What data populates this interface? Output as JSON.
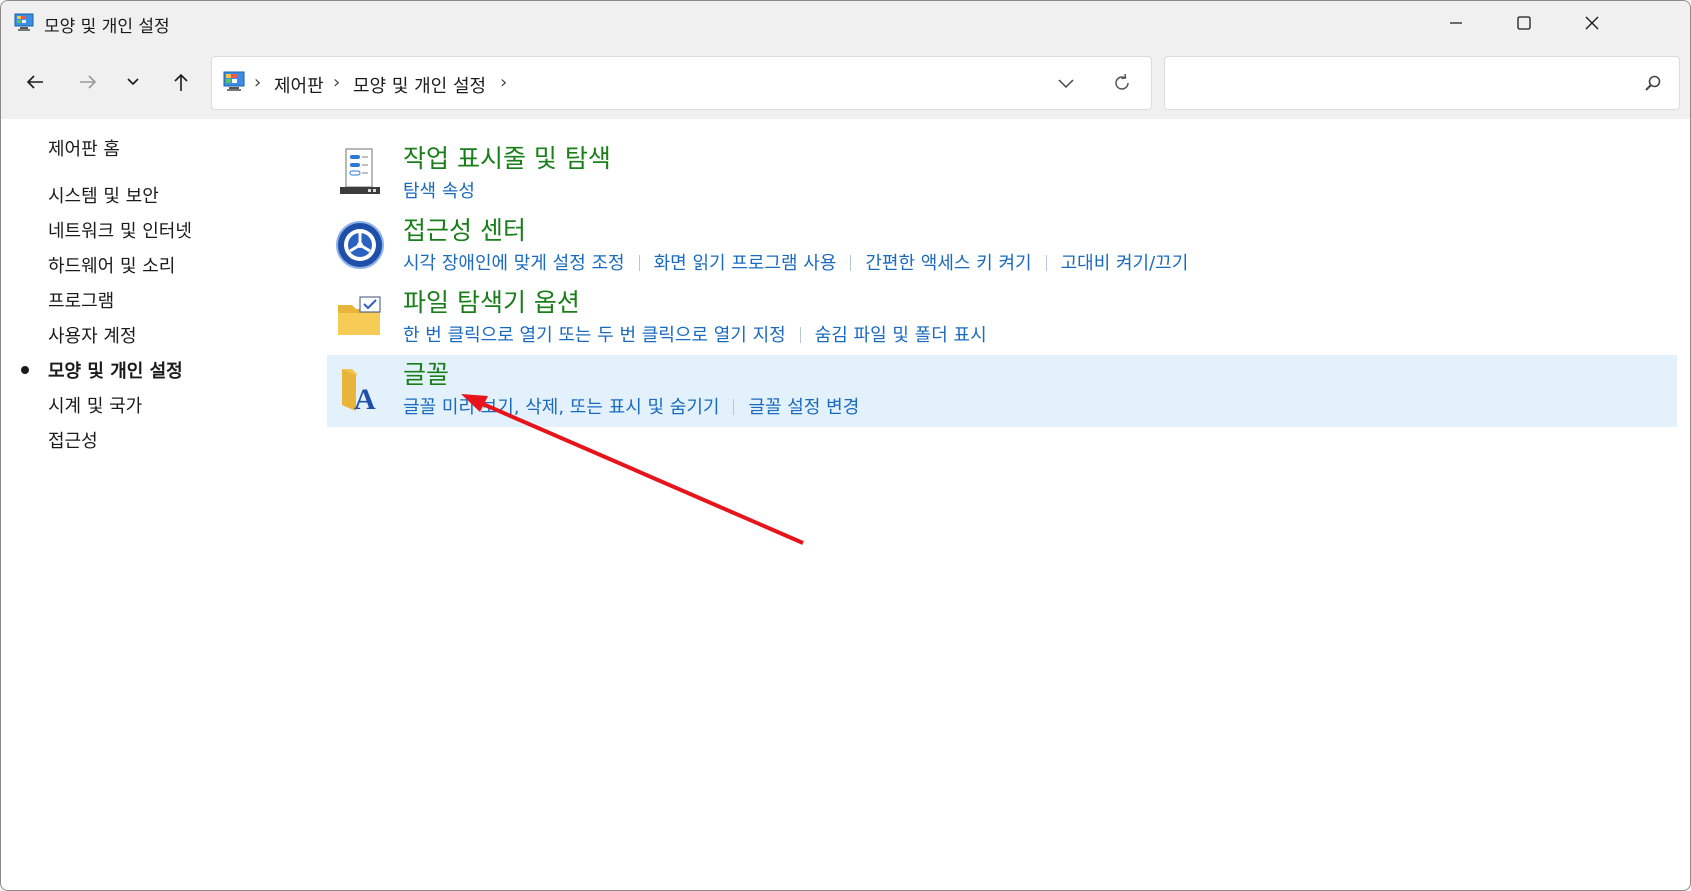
{
  "window": {
    "title": "모양 및 개인 설정",
    "icon": "control-panel-icon"
  },
  "navbar": {
    "breadcrumb": [
      "제어판",
      "모양 및 개인 설정"
    ],
    "search_placeholder": ""
  },
  "sidebar": {
    "home": "제어판 홈",
    "items": [
      {
        "label": "시스템 및 보안",
        "active": false
      },
      {
        "label": "네트워크 및 인터넷",
        "active": false
      },
      {
        "label": "하드웨어 및 소리",
        "active": false
      },
      {
        "label": "프로그램",
        "active": false
      },
      {
        "label": "사용자 계정",
        "active": false
      },
      {
        "label": "모양 및 개인 설정",
        "active": true
      },
      {
        "label": "시계 및 국가",
        "active": false
      },
      {
        "label": "접근성",
        "active": false
      }
    ]
  },
  "categories": [
    {
      "title": "작업 표시줄 및 탐색",
      "icon": "taskbar-icon",
      "links": [
        "탐색 속성"
      ]
    },
    {
      "title": "접근성 센터",
      "icon": "ease-of-access-icon",
      "links": [
        "시각 장애인에 맞게 설정 조정",
        "화면 읽기 프로그램 사용",
        "간편한 액세스 키 켜기",
        "고대비 켜기/끄기"
      ]
    },
    {
      "title": "파일 탐색기 옵션",
      "icon": "folder-options-icon",
      "links": [
        "한 번 클릭으로 열기 또는 두 번 클릭으로 열기 지정",
        "숨김 파일 및 폴더 표시"
      ]
    },
    {
      "title": "글꼴",
      "icon": "fonts-folder-icon",
      "highlighted": true,
      "links": [
        "글꼴 미리 보기, 삭제, 또는 표시 및 숨기기",
        "글꼴 설정 변경"
      ]
    }
  ],
  "colors": {
    "category_title": "#1a7f1a",
    "link": "#1a6bbf",
    "highlight": "#e3f1fc",
    "annotation_arrow": "#e8141b"
  }
}
